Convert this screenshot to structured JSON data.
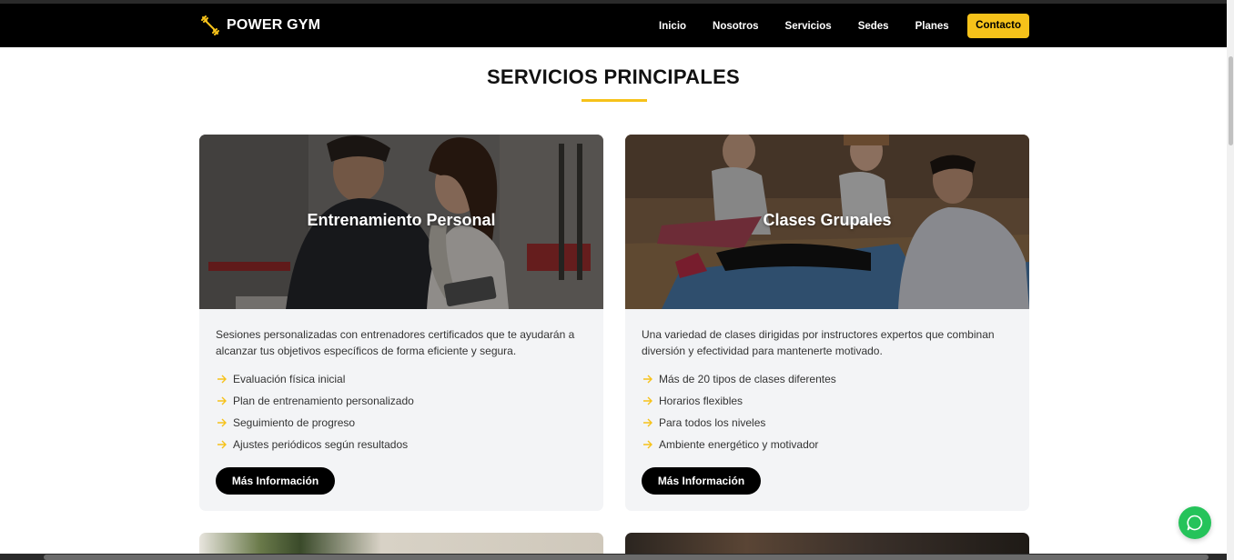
{
  "brand": {
    "name": "POWER GYM",
    "icon": "dumbbell-icon",
    "accent": "#f6c21a"
  },
  "nav": {
    "items": [
      "Inicio",
      "Nosotros",
      "Servicios",
      "Sedes",
      "Planes"
    ],
    "cta": "Contacto"
  },
  "section": {
    "title": "SERVICIOS PRINCIPALES"
  },
  "cards": [
    {
      "title": "Entrenamiento Personal",
      "description": "Sesiones personalizadas con entrenadores certificados que te ayudarán a alcanzar tus objetivos específicos de forma eficiente y segura.",
      "features": [
        "Evaluación física inicial",
        "Plan de entrenamiento personalizado",
        "Seguimiento de progreso",
        "Ajustes periódicos según resultados"
      ],
      "button": "Más Información"
    },
    {
      "title": "Clases Grupales",
      "description": "Una variedad de clases dirigidas por instructores expertos que combinan diversión y efectividad para mantenerte motivado.",
      "features": [
        "Más de 20 tipos de clases diferentes",
        "Horarios flexibles",
        "Para todos los niveles",
        "Ambiente energético y motivador"
      ],
      "button": "Más Información"
    }
  ],
  "floating": {
    "icon": "whatsapp-chat-icon",
    "color": "#25c35a"
  }
}
